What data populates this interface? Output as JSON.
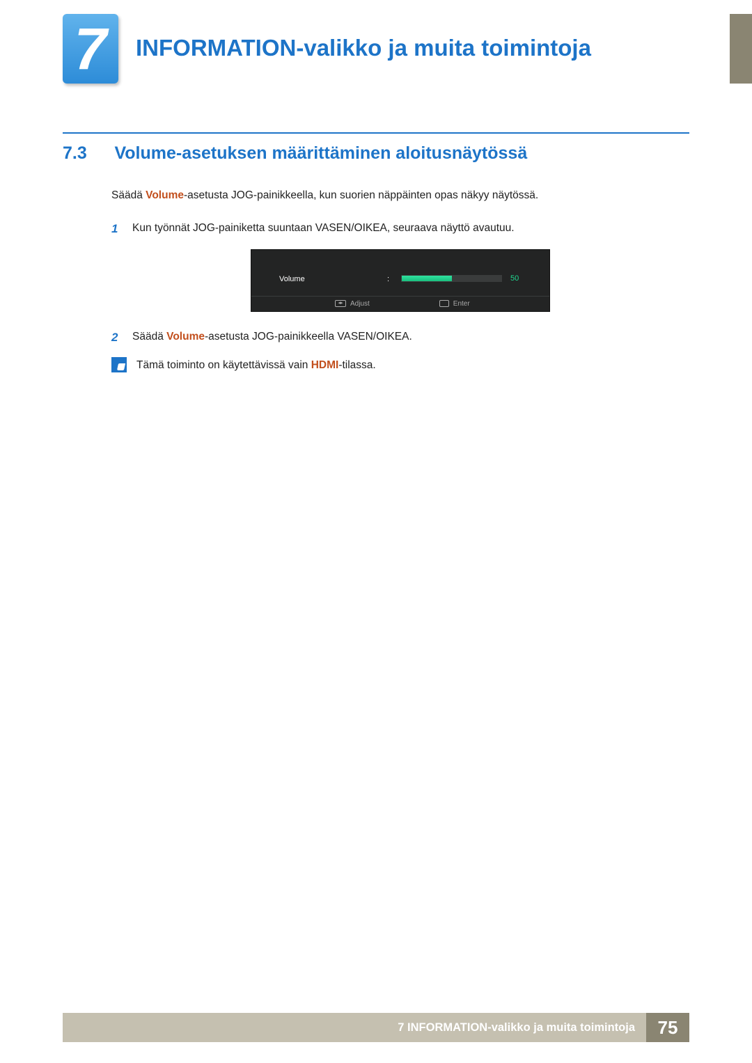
{
  "chapter": {
    "number": "7",
    "title": "INFORMATION-valikko ja muita toimintoja"
  },
  "section": {
    "number": "7.3",
    "title": "Volume-asetuksen määrittäminen aloitusnäytössä"
  },
  "intro": {
    "pre": "Säädä ",
    "highlight": "Volume",
    "post": "-asetusta JOG-painikkeella, kun suorien näppäinten opas näkyy näytössä."
  },
  "steps": [
    {
      "num": "1",
      "text": "Kun työnnät JOG-painiketta suuntaan VASEN/OIKEA, seuraava näyttö avautuu."
    },
    {
      "num": "2",
      "pre": "Säädä ",
      "highlight": "Volume",
      "post": "-asetusta JOG-painikkeella VASEN/OIKEA."
    }
  ],
  "osd": {
    "label": "Volume",
    "value": "50",
    "footer": {
      "adjust": "Adjust",
      "enter": "Enter"
    }
  },
  "note": {
    "pre": "Tämä toiminto on käytettävissä vain ",
    "highlight": "HDMI",
    "post": "-tilassa."
  },
  "footer": {
    "text": "7 INFORMATION-valikko ja muita toimintoja",
    "page": "75"
  }
}
